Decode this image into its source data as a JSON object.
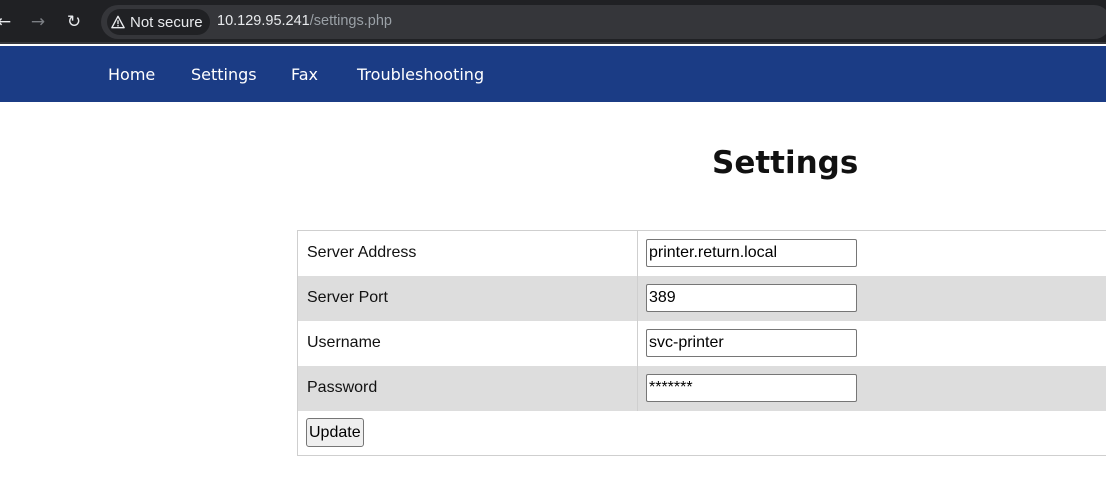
{
  "browser": {
    "back_icon": "←",
    "forward_icon": "→",
    "reload_icon": "↻",
    "security_label": "Not secure",
    "url_host": "10.129.95.241",
    "url_path": "/settings.php"
  },
  "nav": {
    "items": [
      {
        "label": "Home"
      },
      {
        "label": "Settings"
      },
      {
        "label": "Fax"
      },
      {
        "label": "Troubleshooting"
      }
    ]
  },
  "page": {
    "title": "Settings"
  },
  "form": {
    "fields": [
      {
        "label": "Server Address",
        "value": "printer.return.local"
      },
      {
        "label": "Server Port",
        "value": "389"
      },
      {
        "label": "Username",
        "value": "svc-printer"
      },
      {
        "label": "Password",
        "value": "*******"
      }
    ],
    "submit_label": "Update"
  },
  "colors": {
    "browser_bg": "#202124",
    "nav_bg": "#1b3c85",
    "row_shade": "#dddddd"
  }
}
